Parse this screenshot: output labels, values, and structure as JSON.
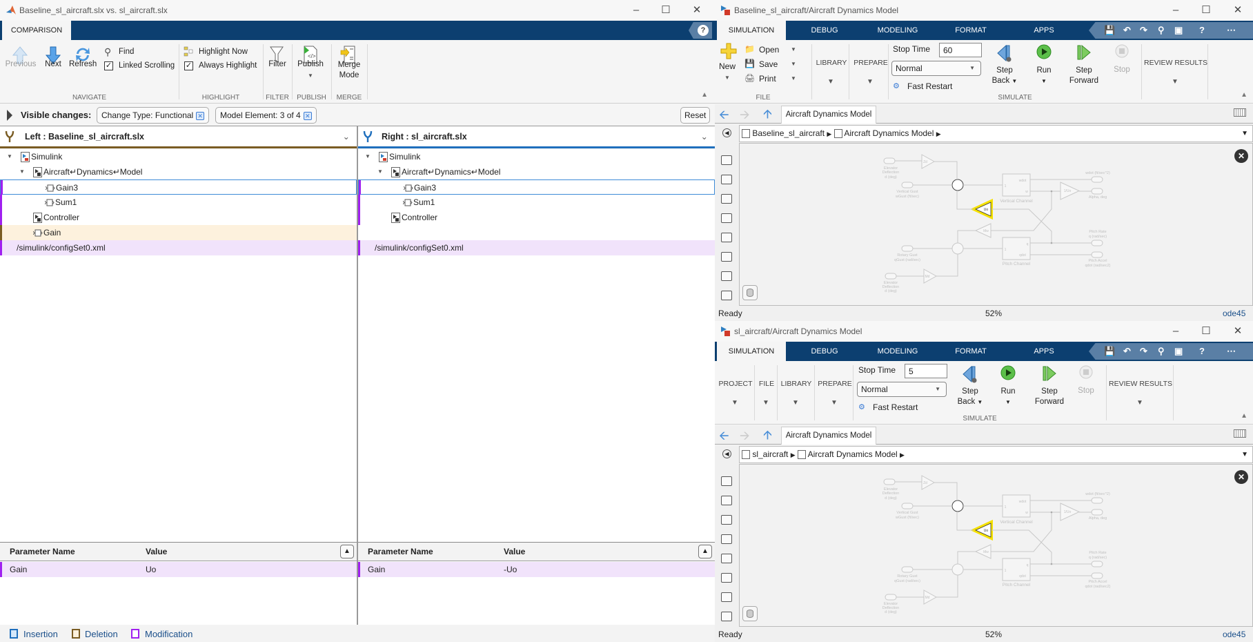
{
  "comparison": {
    "title": "Baseline_sl_aircraft.slx vs. sl_aircraft.slx",
    "tab": "COMPARISON",
    "navigate": {
      "previous": "Previous",
      "next": "Next",
      "refresh": "Refresh",
      "find": "Find",
      "linked_scrolling": "Linked Scrolling",
      "linked_scrolling_checked": true,
      "label": "NAVIGATE"
    },
    "highlight": {
      "highlight_now": "Highlight Now",
      "always_highlight": "Always Highlight",
      "always_highlight_checked": true,
      "label": "HIGHLIGHT"
    },
    "filter": {
      "button": "Filter",
      "label": "FILTER"
    },
    "publish": {
      "button": "Publish",
      "label": "PUBLISH"
    },
    "merge": {
      "button_line1": "Merge",
      "button_line2": "Mode",
      "label": "MERGE"
    },
    "visible_changes": {
      "label": "Visible changes:",
      "chips": [
        "Change Type: Functional",
        "Model Element: 3 of 4"
      ],
      "reset": "Reset"
    },
    "left": {
      "header": "Left : Baseline_sl_aircraft.slx",
      "rows": [
        {
          "label": "Simulink",
          "level": 0,
          "icon": "simulink-model-icon",
          "state": ""
        },
        {
          "label": "Aircraft↵Dynamics↵Model",
          "level": 1,
          "icon": "subsystem-icon",
          "state": ""
        },
        {
          "label": "Gain3",
          "level": 2,
          "icon": "block-icon",
          "state": "modified-selected"
        },
        {
          "label": "Sum1",
          "level": 2,
          "icon": "block-icon",
          "state": "modified"
        },
        {
          "label": "Controller",
          "level": 1,
          "icon": "subsystem-leaf-icon",
          "state": "modified"
        },
        {
          "label": "Gain",
          "level": 1,
          "icon": "block-icon",
          "state": "deleted"
        },
        {
          "label": "/simulink/configSet0.xml",
          "level": -1,
          "icon": "",
          "state": "modified-bg"
        }
      ],
      "params": {
        "col_name": "Parameter Name",
        "col_value": "Value",
        "rows": [
          {
            "name": "Gain",
            "value": "Uo"
          }
        ]
      }
    },
    "right": {
      "header": "Right : sl_aircraft.slx",
      "rows": [
        {
          "label": "Simulink",
          "level": 0,
          "icon": "simulink-model-icon",
          "state": ""
        },
        {
          "label": "Aircraft↵Dynamics↵Model",
          "level": 1,
          "icon": "subsystem-icon",
          "state": ""
        },
        {
          "label": "Gain3",
          "level": 2,
          "icon": "block-icon",
          "state": "modified-selected"
        },
        {
          "label": "Sum1",
          "level": 2,
          "icon": "block-icon",
          "state": "modified"
        },
        {
          "label": "Controller",
          "level": 1,
          "icon": "subsystem-leaf-icon",
          "state": "modified"
        },
        {
          "label": "",
          "level": -1,
          "icon": "",
          "state": "empty"
        },
        {
          "label": "/simulink/configSet0.xml",
          "level": -1,
          "icon": "",
          "state": "modified-bg"
        }
      ],
      "params": {
        "col_name": "Parameter Name",
        "col_value": "Value",
        "rows": [
          {
            "name": "Gain",
            "value": "-Uo"
          }
        ]
      }
    },
    "legend": [
      {
        "label": "Insertion",
        "color": "#1f6fbd"
      },
      {
        "label": "Deletion",
        "color": "#7a5c23"
      },
      {
        "label": "Modification",
        "color": "#a020f0"
      }
    ]
  },
  "colors": {
    "toolstrip": "#0c3f70",
    "modification": "#a020f0",
    "deletion": "#7a5c23",
    "insertion": "#1f6fbd",
    "highlight": "#f5e100"
  },
  "simTop": {
    "title": "Baseline_sl_aircraft/Aircraft Dynamics Model",
    "tabs": [
      "SIMULATION",
      "DEBUG",
      "MODELING",
      "FORMAT",
      "APPS"
    ],
    "file": {
      "new": "New",
      "open": "Open",
      "save": "Save",
      "print": "Print",
      "label": "FILE"
    },
    "groups": {
      "project": "",
      "file": "",
      "library": "LIBRARY",
      "prepare": "PREPARE",
      "review": "REVIEW RESULTS"
    },
    "stop_time_label": "Stop Time",
    "stop_time": "60",
    "mode": "Normal",
    "fast_restart": "Fast Restart",
    "step_back_1": "Step",
    "step_back_2": "Back",
    "run": "Run",
    "step_fwd_1": "Step",
    "step_fwd_2": "Forward",
    "stop": "Stop",
    "simulate_label": "SIMULATE",
    "nav_tab": "Aircraft Dynamics Model",
    "breadcrumb": [
      "Baseline_sl_aircraft",
      "Aircraft Dynamics Model"
    ],
    "status": {
      "left": "Ready",
      "zoom": "52%",
      "solver": "ode45"
    }
  },
  "simBottom": {
    "title": "sl_aircraft/Aircraft Dynamics Model",
    "tabs": [
      "SIMULATION",
      "DEBUG",
      "MODELING",
      "FORMAT",
      "APPS"
    ],
    "groups": {
      "project": "PROJECT",
      "file": "FILE",
      "library": "LIBRARY",
      "prepare": "PREPARE",
      "review": "REVIEW RESULTS"
    },
    "stop_time_label": "Stop Time",
    "stop_time": "5",
    "mode": "Normal",
    "fast_restart": "Fast Restart",
    "step_back_1": "Step",
    "step_back_2": "Back",
    "run": "Run",
    "step_fwd_1": "Step",
    "step_fwd_2": "Forward",
    "stop": "Stop",
    "simulate_label": "SIMULATE",
    "nav_tab": "Aircraft Dynamics Model",
    "breadcrumb": [
      "sl_aircraft",
      "Aircraft Dynamics Model"
    ],
    "status": {
      "left": "Ready",
      "zoom": "52%",
      "solver": "ode45"
    }
  },
  "diagram": {
    "gains": {
      "zd": "Zd",
      "uo": "Uo",
      "mw": "Mw",
      "md": "Md",
      "inv_uo": "1/Uo"
    },
    "inports": {
      "elev1": [
        "Elevator",
        "Deflection",
        "d (deg)"
      ],
      "vgust": [
        "Vertical Gust",
        "wGust (ft/sec)"
      ],
      "rgust": [
        "Rotary Gust",
        "qGust (rad/sec)"
      ],
      "elev2": [
        "Elevator",
        "Deflection",
        "d (deg)"
      ]
    },
    "outports": {
      "wdot": [
        "wdot (ft/sec^2)"
      ],
      "alpha": [
        "Alpha, deg"
      ],
      "q": [
        "Pitch Rate",
        "q (rad/sec)"
      ],
      "qdot": [
        "Pitch Accel",
        "qdot (rad/sec2)"
      ]
    },
    "vertical": {
      "name": "Vertical Channel",
      "in": "1",
      "out1": "wdot",
      "out2": "w"
    },
    "pitch": {
      "name": "Pitch Channel",
      "in": "1",
      "out1": "q",
      "out2": "qdot"
    }
  }
}
